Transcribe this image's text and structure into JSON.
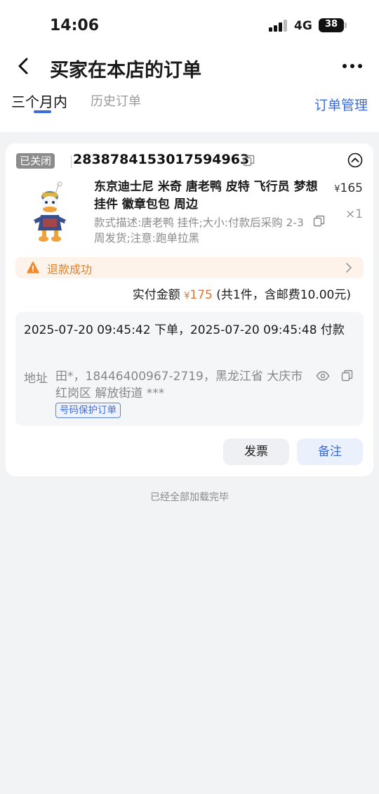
{
  "status_bar": {
    "time": "14:06",
    "network": "4G",
    "battery": "38"
  },
  "header": {
    "title": "买家在本店的订单"
  },
  "tabs": [
    {
      "label": "三个月内",
      "active": true
    },
    {
      "label": "历史订单",
      "active": false
    }
  ],
  "manage_link": "订单管理",
  "order": {
    "status_badge": "已关闭",
    "order_number": "2838784153017594963",
    "product": {
      "title": "东京迪士尼 米奇 唐老鸭 皮特 飞行员 梦想 挂件 徽章包包 周边",
      "spec": "款式描述:唐老鸭 挂件;大小:付款后采购 2-3周发货;注意:跑单拉黑",
      "price_symbol": "¥",
      "price": "165",
      "quantity": "×1"
    },
    "refund_status": "退款成功",
    "paid": {
      "label": "实付金额",
      "symbol": "¥",
      "amount": "175",
      "detail": "(共1件，含邮费10.00元)"
    },
    "times": "2025-07-20 09:45:42 下单，2025-07-20 09:45:48 付款",
    "address": {
      "label": "地址",
      "text": "田*，18446400967-2719，黑龙江省 大庆市 红岗区 解放街道 ***",
      "tag": "号码保护订单"
    },
    "buttons": {
      "invoice": "发票",
      "remark": "备注"
    }
  },
  "footer": "已经全部加载完毕",
  "colors": {
    "accent": "#3d6bd8",
    "orange": "#e3742e",
    "badge": "#8c8c8c"
  },
  "icons": [
    "back-icon",
    "more-icon",
    "copy-icon",
    "collapse-up-icon",
    "warning-icon",
    "chevron-right-icon",
    "eye-icon"
  ]
}
